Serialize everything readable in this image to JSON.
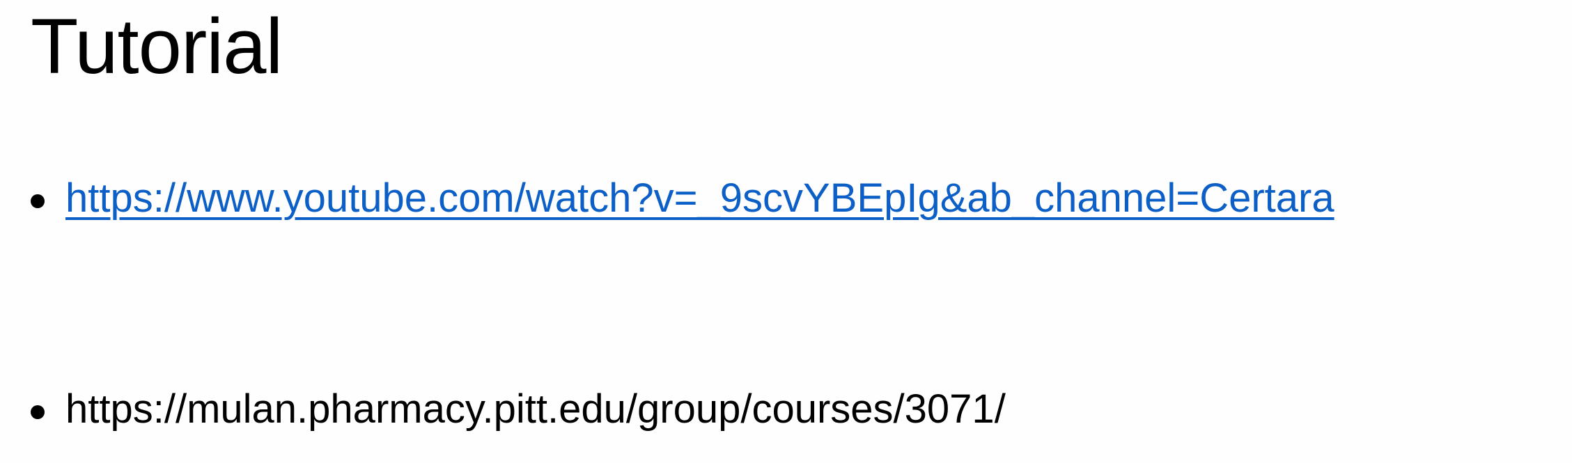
{
  "slide": {
    "title": "Tutorial",
    "bullets": [
      {
        "text": "https://www.youtube.com/watch?v=_9scvYBEpIg&ab_channel=Certara",
        "is_link": true
      },
      {
        "text": "https://mulan.pharmacy.pitt.edu/group/courses/3071/",
        "is_link": false
      }
    ],
    "link_color": "#0b5fc6"
  }
}
